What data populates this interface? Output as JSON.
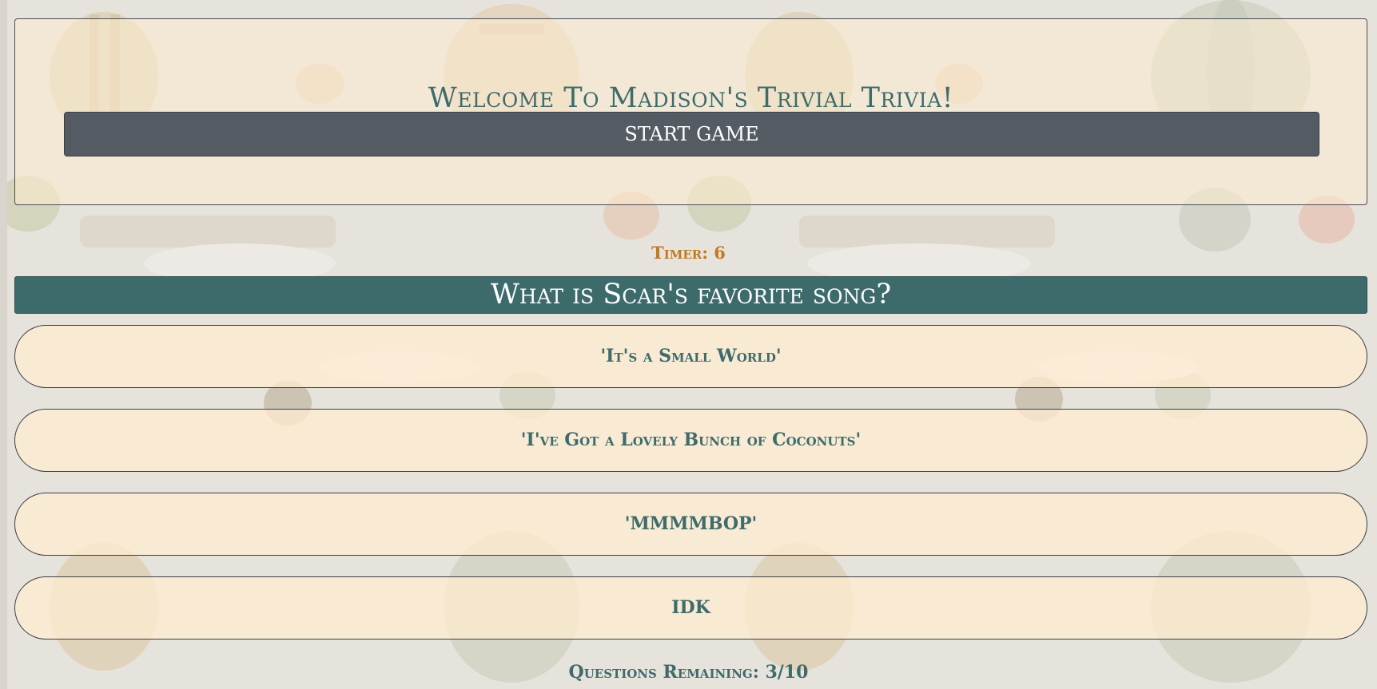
{
  "welcome": {
    "title": "Welcome To Madison's Trivial Trivia!",
    "start_button_label": "START GAME"
  },
  "timer": {
    "text": "Timer: 6"
  },
  "question": {
    "text": "What is Scar's favorite song?"
  },
  "answers": [
    {
      "label": "'It's a Small World'"
    },
    {
      "label": "'I've Got a Lovely Bunch of Coconuts'"
    },
    {
      "label": "'MMMMBOP'"
    },
    {
      "label": "IDK"
    }
  ],
  "progress": {
    "text": "Questions Remaining: 3/10",
    "remaining": 3,
    "total": 10
  },
  "colors": {
    "accent_teal": "#3d6b6b",
    "timer_orange": "#c27a22",
    "button_gray": "#555b63",
    "panel_cream": "#fdecd0"
  },
  "background": {
    "motif": "hot-air-balloon-wallpaper"
  }
}
